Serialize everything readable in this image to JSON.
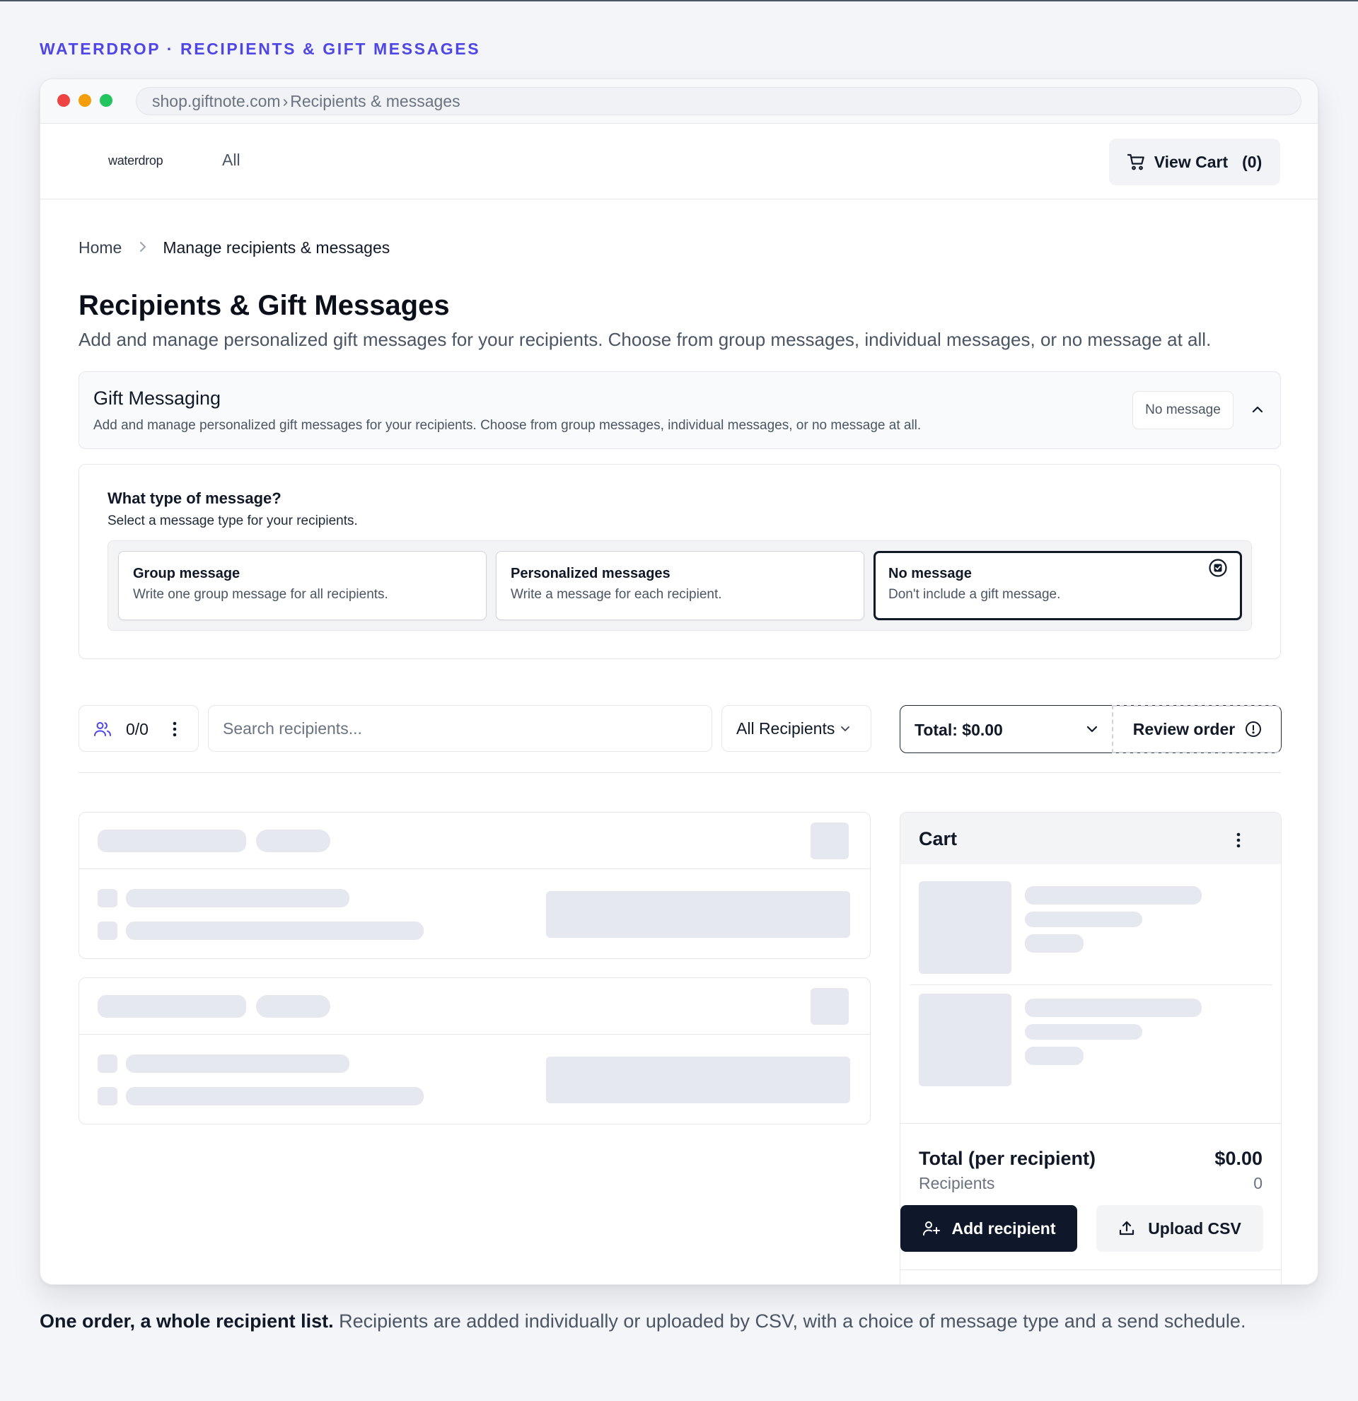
{
  "eyebrow": "WATERDROP · RECIPIENTS & GIFT MESSAGES",
  "browser": {
    "url_host": "shop.giftnote.com",
    "url_sep": "›",
    "url_path": "Recipients & messages"
  },
  "nav": {
    "logo": "waterdrop",
    "all_label": "All",
    "cart_label": "View Cart",
    "cart_count": "(0)"
  },
  "breadcrumb": {
    "home": "Home",
    "current": "Manage recipients & messages"
  },
  "page": {
    "title": "Recipients & Gift Messages",
    "subtitle": "Add and manage personalized gift messages for your recipients. Choose from group messages, individual messages, or no message at all."
  },
  "gift_messaging": {
    "title": "Gift Messaging",
    "description": "Add and manage personalized gift messages for your recipients. Choose from group messages, individual messages, or no message at all.",
    "badge": "No message"
  },
  "message_type": {
    "question": "What type of message?",
    "subtitle": "Select a message type for your recipients.",
    "options": [
      {
        "title": "Group message",
        "description": "Write one group message for all recipients.",
        "selected": false
      },
      {
        "title": "Personalized messages",
        "description": "Write a message for each recipient.",
        "selected": false
      },
      {
        "title": "No message",
        "description": "Don't include a gift message.",
        "selected": true
      }
    ]
  },
  "toolbar": {
    "count": "0/0",
    "search_placeholder": "Search recipients...",
    "filter_label": "All Recipients",
    "total_label": "Total: $0.00",
    "review_label": "Review order"
  },
  "cart": {
    "title": "Cart",
    "total_label": "Total (per recipient)",
    "total_value": "$0.00",
    "recipients_label": "Recipients",
    "recipients_value": "0",
    "add_label": "Add recipient",
    "upload_label": "Upload CSV"
  },
  "caption": {
    "lead": "One order, a whole recipient list.",
    "body": " Recipients are added individually or uploaded by CSV, with a choice of message type and a send schedule."
  },
  "colors": {
    "accent": "#4f46e5",
    "primary_button": "#0f172a",
    "skeleton": "#e5e8ef"
  }
}
